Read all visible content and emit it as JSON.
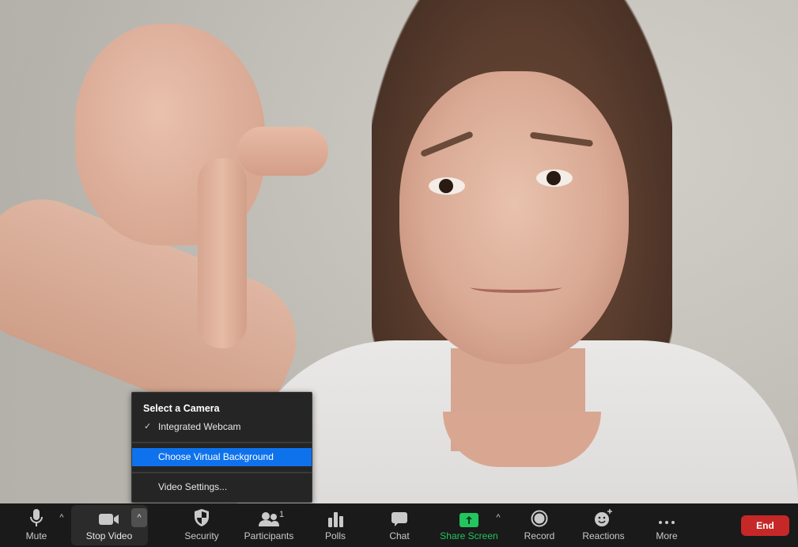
{
  "video": {
    "description": "participant video feed"
  },
  "camera_menu": {
    "title": "Select a Camera",
    "items": [
      {
        "label": "Integrated Webcam",
        "checked": true,
        "highlighted": false
      },
      {
        "label": "Choose Virtual Background",
        "checked": false,
        "highlighted": true
      },
      {
        "label": "Video Settings...",
        "checked": false,
        "highlighted": false
      }
    ],
    "check_glyph": "✓",
    "highlight_color": "#0e72ed"
  },
  "toolbar": {
    "mute": {
      "label": "Mute",
      "icon": "microphone-icon"
    },
    "stop_video": {
      "label": "Stop Video",
      "icon": "video-camera-icon"
    },
    "security": {
      "label": "Security",
      "icon": "shield-icon"
    },
    "participants": {
      "label": "Participants",
      "icon": "participants-icon",
      "count": "1"
    },
    "polls": {
      "label": "Polls",
      "icon": "bar-chart-icon"
    },
    "chat": {
      "label": "Chat",
      "icon": "chat-bubble-icon"
    },
    "share_screen": {
      "label": "Share Screen",
      "icon": "share-arrow-icon",
      "color": "#22c55e"
    },
    "record": {
      "label": "Record",
      "icon": "record-icon"
    },
    "reactions": {
      "label": "Reactions",
      "icon": "smiley-plus-icon"
    },
    "more": {
      "label": "More",
      "icon": "ellipsis-icon"
    },
    "end": {
      "label": "End",
      "color": "#c62828"
    },
    "caret_glyph": "^"
  }
}
